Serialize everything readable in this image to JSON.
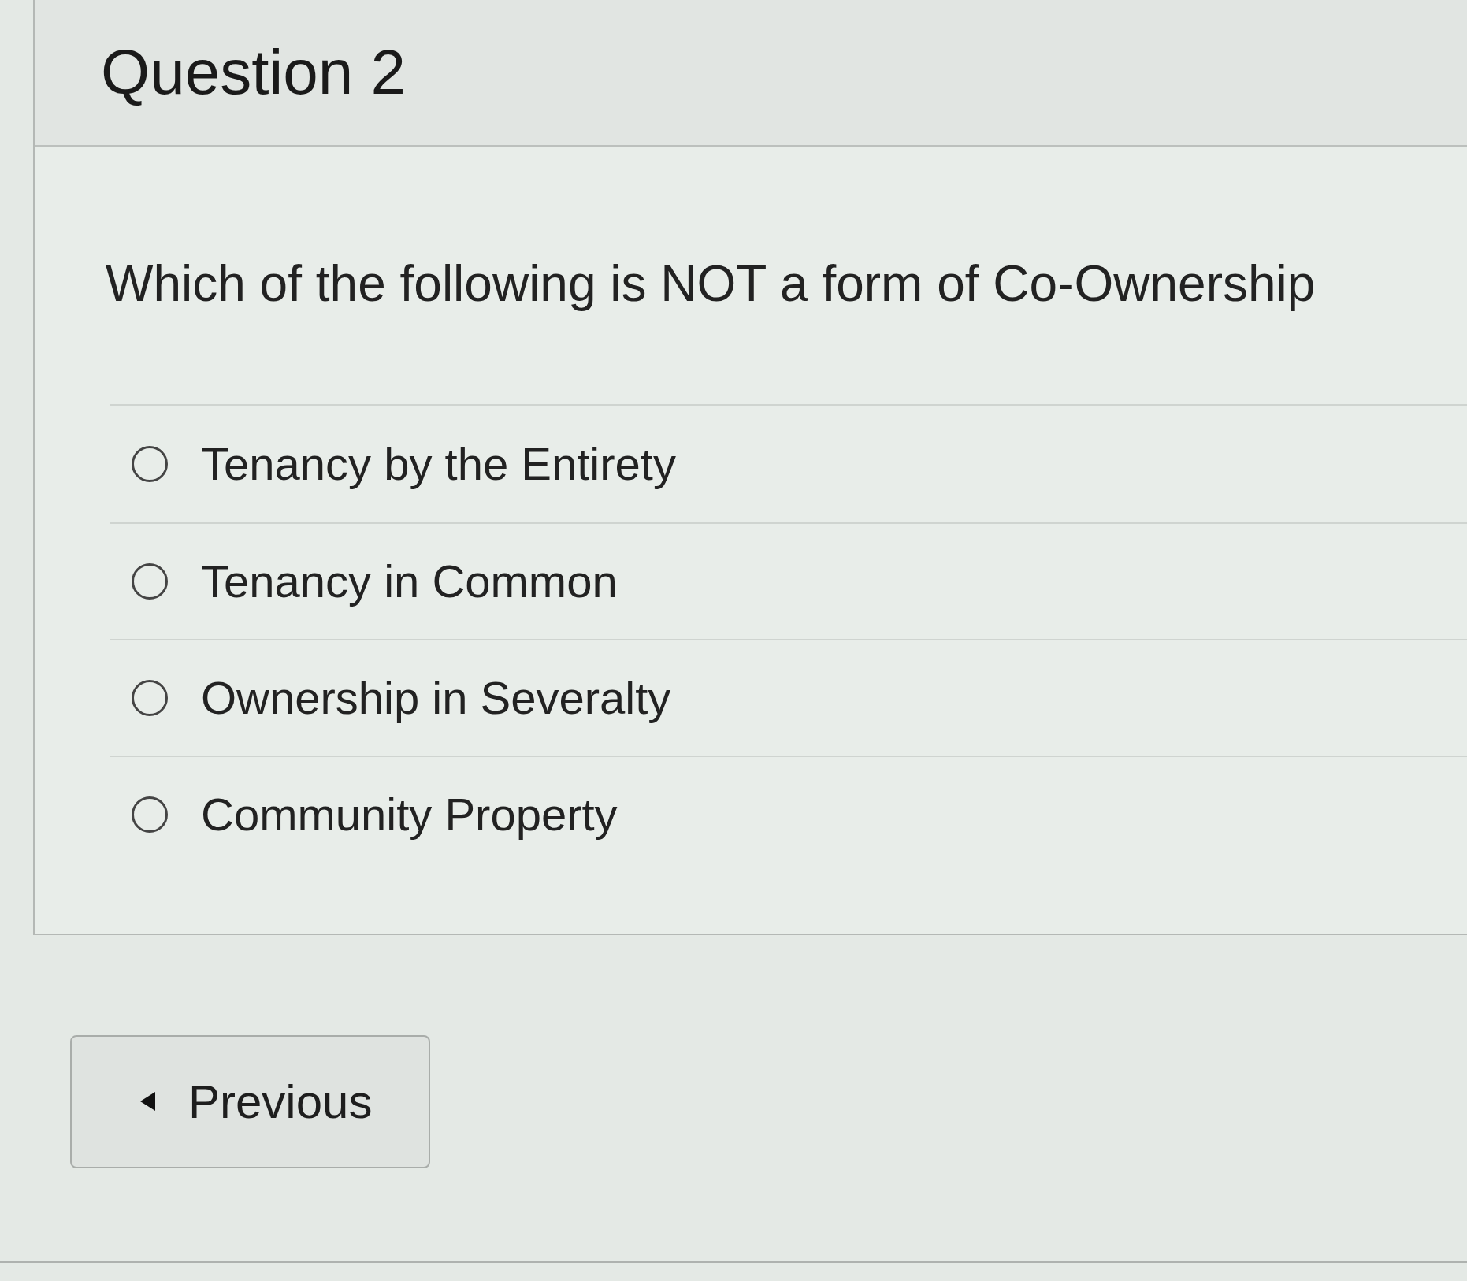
{
  "question": {
    "title": "Question 2",
    "text": "Which of the following is NOT a form of Co-Ownership",
    "answers": [
      {
        "label": "Tenancy by the Entirety",
        "selected": false
      },
      {
        "label": "Tenancy in Common",
        "selected": false
      },
      {
        "label": "Ownership in Severalty",
        "selected": false
      },
      {
        "label": "Community Property",
        "selected": false
      }
    ]
  },
  "navigation": {
    "previous": "Previous"
  }
}
